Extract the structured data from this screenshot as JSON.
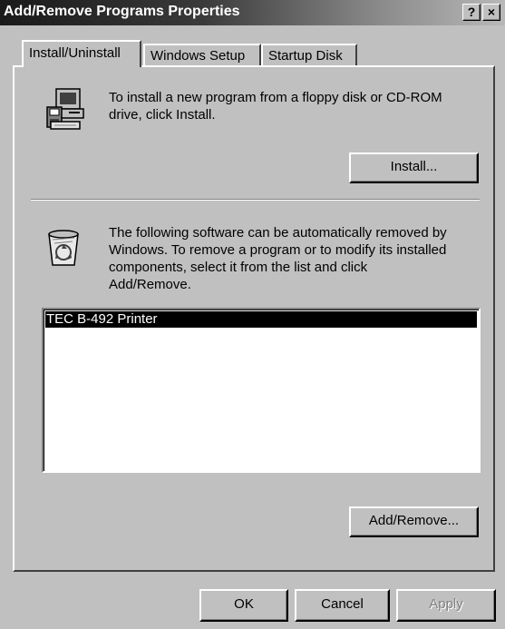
{
  "window": {
    "title": "Add/Remove Programs Properties",
    "help_button": "?",
    "close_button": "×"
  },
  "tabs": [
    {
      "label": "Install/Uninstall",
      "active": true
    },
    {
      "label": "Windows Setup",
      "active": false
    },
    {
      "label": "Startup Disk",
      "active": false
    }
  ],
  "install_section": {
    "icon": "computer-floppy-icon",
    "text": "To install a new program from a floppy disk or CD-ROM\ndrive, click Install.",
    "button_label": "Install..."
  },
  "uninstall_section": {
    "icon": "recycle-bin-icon",
    "text": "The following software can be automatically removed by\nWindows. To remove a program or to modify its installed\ncomponents, select it from the list and click\nAdd/Remove.",
    "programs": [
      {
        "name": "TEC B-492 Printer",
        "selected": true
      }
    ],
    "button_label": "Add/Remove..."
  },
  "footer": {
    "ok_label": "OK",
    "cancel_label": "Cancel",
    "apply_label": "Apply"
  }
}
